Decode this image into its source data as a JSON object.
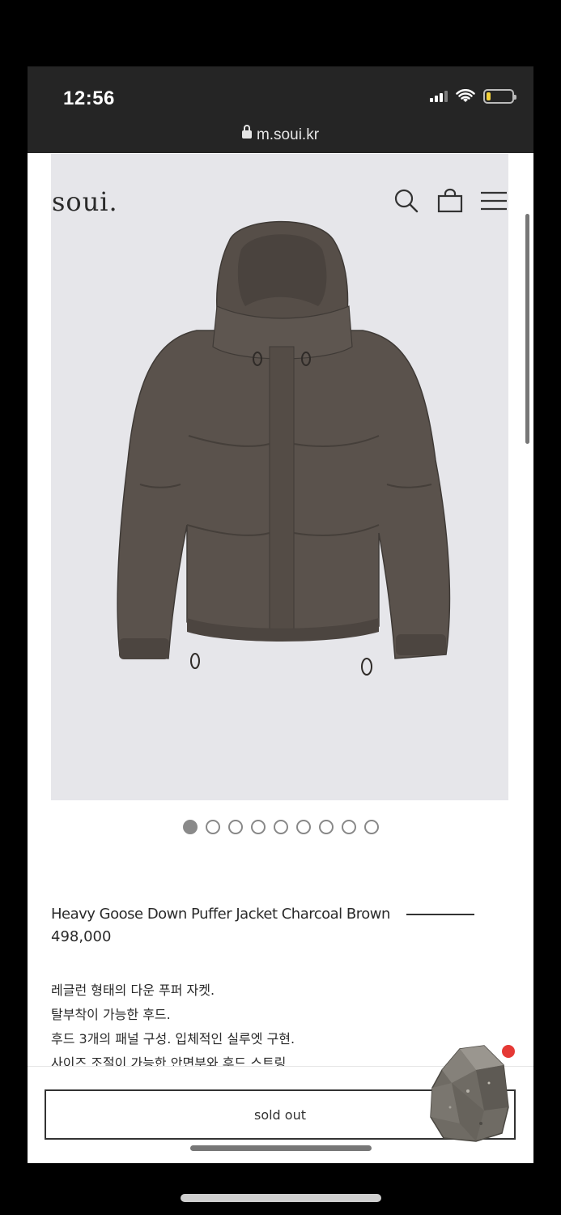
{
  "status_bar": {
    "time": "12:56"
  },
  "browser": {
    "url": "m.soui.kr"
  },
  "header": {
    "logo": "soui."
  },
  "carousel": {
    "total": 9,
    "active_index": 0
  },
  "product": {
    "name": "Heavy Goose Down Puffer Jacket Charcoal Brown",
    "price": "498,000",
    "description": [
      "레글런 형태의 다운 푸퍼 자켓.",
      "탈부착이 가능한 후드.",
      "후드 3개의 패널 구성. 입체적인 실루엣 구현.",
      "사이즈 조절이 가능한 안면부와 후드 스트링."
    ]
  },
  "actions": {
    "sold_out_label": "sold out"
  },
  "colors": {
    "jacket": "#5a524c",
    "hero_bg": "#e6e6ea",
    "notification": "#e53935"
  },
  "icons": [
    "lock-icon",
    "search-icon",
    "bag-icon",
    "menu-icon",
    "signal-icon",
    "wifi-icon",
    "battery-icon"
  ]
}
